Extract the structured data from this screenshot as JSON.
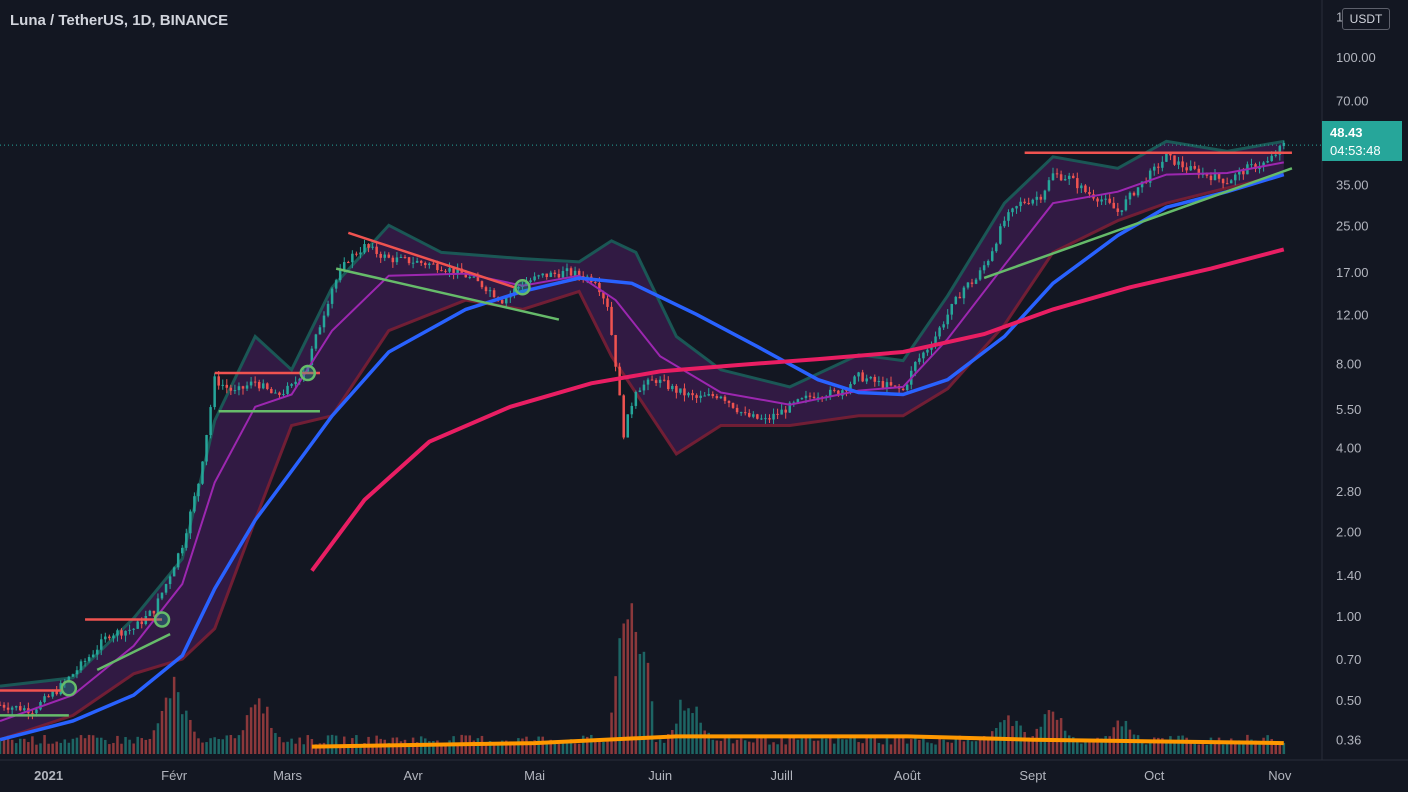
{
  "header": {
    "symbol_title": "Luna / TetherUS, 1D, BINANCE",
    "currency_label": "USDT"
  },
  "price_axis": {
    "ticks": [
      "140.00",
      "100.00",
      "70.00",
      "35.00",
      "25.00",
      "17.00",
      "12.00",
      "8.00",
      "5.50",
      "4.00",
      "2.80",
      "2.00",
      "1.40",
      "1.00",
      "0.70",
      "0.50",
      "0.36"
    ]
  },
  "time_axis": {
    "ticks": [
      "2021",
      "Févr",
      "Mars",
      "Avr",
      "Mai",
      "Juin",
      "Juill",
      "Août",
      "Sept",
      "Oct",
      "Nov"
    ]
  },
  "last_price": {
    "value": "48.43",
    "countdown": "04:53:48"
  },
  "colors": {
    "background": "#131722",
    "up": "#26a69a",
    "down": "#ef5350",
    "ma_fast": "#9c27b0",
    "ma_mid": "#2962ff",
    "ma_slow": "#e91e63",
    "volume_ma": "#ff9800",
    "band_fill": "#4a1d5e",
    "band_upper": "#1b5e5a",
    "band_lower": "#7a1f35",
    "resistance_line": "#f05350",
    "support_line": "#66bb6a"
  },
  "chart_data": {
    "type": "line",
    "scale": "log",
    "ylim": [
      0.32,
      150
    ],
    "x_range": [
      "2020-12-20",
      "2021-11-05"
    ],
    "series": [
      {
        "name": "",
        "kind": "price_path",
        "points": [
          [
            "2020-12-20",
            0.48
          ],
          [
            "2020-12-28",
            0.46
          ],
          [
            "2021-01-03",
            0.54
          ],
          [
            "2021-01-07",
            0.62
          ],
          [
            "2021-01-12",
            0.74
          ],
          [
            "2021-01-16",
            0.86
          ],
          [
            "2021-01-22",
            0.9
          ],
          [
            "2021-01-27",
            1.05
          ],
          [
            "2021-01-30",
            1.3
          ],
          [
            "2021-02-03",
            1.8
          ],
          [
            "2021-02-07",
            3.0
          ],
          [
            "2021-02-09",
            4.5
          ],
          [
            "2021-02-11",
            7.0
          ],
          [
            "2021-02-16",
            6.3
          ],
          [
            "2021-02-21",
            6.9
          ],
          [
            "2021-02-26",
            6.1
          ],
          [
            "2021-03-02",
            6.6
          ],
          [
            "2021-03-06",
            8.0
          ],
          [
            "2021-03-09",
            11.0
          ],
          [
            "2021-03-12",
            15.0
          ],
          [
            "2021-03-16",
            19.0
          ],
          [
            "2021-03-20",
            21.0
          ],
          [
            "2021-03-26",
            19.0
          ],
          [
            "2021-04-02",
            18.5
          ],
          [
            "2021-04-08",
            17.8
          ],
          [
            "2021-04-14",
            16.5
          ],
          [
            "2021-04-19",
            15.0
          ],
          [
            "2021-04-23",
            13.5
          ],
          [
            "2021-04-28",
            15.5
          ],
          [
            "2021-05-03",
            16.5
          ],
          [
            "2021-05-09",
            17.0
          ],
          [
            "2021-05-16",
            16.0
          ],
          [
            "2021-05-19",
            13.0
          ],
          [
            "2021-05-21",
            8.0
          ],
          [
            "2021-05-23",
            4.5
          ],
          [
            "2021-05-26",
            6.5
          ],
          [
            "2021-05-31",
            7.0
          ],
          [
            "2021-06-05",
            6.4
          ],
          [
            "2021-06-10",
            6.0
          ],
          [
            "2021-06-16",
            6.2
          ],
          [
            "2021-06-22",
            5.2
          ],
          [
            "2021-06-27",
            5.0
          ],
          [
            "2021-07-03",
            5.6
          ],
          [
            "2021-07-09",
            6.2
          ],
          [
            "2021-07-15",
            6.3
          ],
          [
            "2021-07-20",
            7.2
          ],
          [
            "2021-07-25",
            6.8
          ],
          [
            "2021-07-31",
            6.4
          ],
          [
            "2021-08-03",
            8.0
          ],
          [
            "2021-08-07",
            9.5
          ],
          [
            "2021-08-11",
            12.0
          ],
          [
            "2021-08-15",
            15.0
          ],
          [
            "2021-08-18",
            16.0
          ],
          [
            "2021-08-21",
            19.0
          ],
          [
            "2021-08-25",
            26.0
          ],
          [
            "2021-08-29",
            30.0
          ],
          [
            "2021-09-03",
            32.0
          ],
          [
            "2021-09-06",
            38.0
          ],
          [
            "2021-09-10",
            37.0
          ],
          [
            "2021-09-14",
            33.0
          ],
          [
            "2021-09-18",
            31.0
          ],
          [
            "2021-09-22",
            28.0
          ],
          [
            "2021-09-26",
            33.0
          ],
          [
            "2021-09-30",
            38.0
          ],
          [
            "2021-10-04",
            44.0
          ],
          [
            "2021-10-09",
            40.0
          ],
          [
            "2021-10-14",
            38.0
          ],
          [
            "2021-10-19",
            36.0
          ],
          [
            "2021-10-24",
            40.0
          ],
          [
            "2021-10-29",
            42.0
          ],
          [
            "2021-11-02",
            48.43
          ]
        ]
      },
      {
        "name": "",
        "kind": "ma_fast",
        "points": [
          [
            "2020-12-20",
            0.42
          ],
          [
            "2021-01-07",
            0.52
          ],
          [
            "2021-01-22",
            0.78
          ],
          [
            "2021-02-03",
            1.3
          ],
          [
            "2021-02-11",
            3.0
          ],
          [
            "2021-02-21",
            5.6
          ],
          [
            "2021-03-02",
            6.2
          ],
          [
            "2021-03-12",
            10.5
          ],
          [
            "2021-03-26",
            16.5
          ],
          [
            "2021-04-14",
            16.8
          ],
          [
            "2021-04-28",
            15.2
          ],
          [
            "2021-05-12",
            16.5
          ],
          [
            "2021-05-21",
            13.5
          ],
          [
            "2021-06-01",
            8.5
          ],
          [
            "2021-06-16",
            6.3
          ],
          [
            "2021-07-03",
            5.7
          ],
          [
            "2021-07-20",
            6.4
          ],
          [
            "2021-07-31",
            6.6
          ],
          [
            "2021-08-11",
            9.8
          ],
          [
            "2021-08-25",
            18.0
          ],
          [
            "2021-09-06",
            30.0
          ],
          [
            "2021-09-22",
            33.0
          ],
          [
            "2021-10-04",
            38.0
          ],
          [
            "2021-10-19",
            38.5
          ],
          [
            "2021-11-02",
            42.0
          ]
        ]
      },
      {
        "name": "",
        "kind": "ma_mid",
        "points": [
          [
            "2020-12-20",
            0.36
          ],
          [
            "2021-01-07",
            0.42
          ],
          [
            "2021-01-22",
            0.52
          ],
          [
            "2021-02-03",
            0.72
          ],
          [
            "2021-02-11",
            1.25
          ],
          [
            "2021-02-21",
            2.2
          ],
          [
            "2021-03-02",
            3.3
          ],
          [
            "2021-03-12",
            5.2
          ],
          [
            "2021-03-26",
            8.8
          ],
          [
            "2021-04-14",
            12.5
          ],
          [
            "2021-04-28",
            14.5
          ],
          [
            "2021-05-12",
            16.2
          ],
          [
            "2021-05-25",
            15.5
          ],
          [
            "2021-06-10",
            12.0
          ],
          [
            "2021-06-25",
            9.2
          ],
          [
            "2021-07-10",
            7.0
          ],
          [
            "2021-07-20",
            6.3
          ],
          [
            "2021-07-31",
            6.2
          ],
          [
            "2021-08-11",
            7.0
          ],
          [
            "2021-08-25",
            10.0
          ],
          [
            "2021-09-06",
            15.5
          ],
          [
            "2021-09-22",
            23.0
          ],
          [
            "2021-10-04",
            29.0
          ],
          [
            "2021-10-19",
            33.0
          ],
          [
            "2021-11-02",
            38.0
          ]
        ]
      },
      {
        "name": "",
        "kind": "ma_slow",
        "points": [
          [
            "2021-03-07",
            1.45
          ],
          [
            "2021-03-20",
            2.6
          ],
          [
            "2021-04-05",
            4.2
          ],
          [
            "2021-04-25",
            5.6
          ],
          [
            "2021-05-15",
            6.8
          ],
          [
            "2021-06-01",
            7.5
          ],
          [
            "2021-06-20",
            7.9
          ],
          [
            "2021-07-10",
            8.3
          ],
          [
            "2021-07-31",
            8.8
          ],
          [
            "2021-08-20",
            10.2
          ],
          [
            "2021-09-06",
            12.5
          ],
          [
            "2021-09-25",
            15.0
          ],
          [
            "2021-10-15",
            17.5
          ],
          [
            "2021-11-02",
            20.5
          ]
        ]
      },
      {
        "name": "",
        "kind": "band_upper",
        "points": [
          [
            "2020-12-20",
            0.56
          ],
          [
            "2021-01-07",
            0.6
          ],
          [
            "2021-01-22",
            0.98
          ],
          [
            "2021-02-03",
            1.6
          ],
          [
            "2021-02-11",
            5.0
          ],
          [
            "2021-02-21",
            10.0
          ],
          [
            "2021-03-02",
            7.6
          ],
          [
            "2021-03-12",
            15.0
          ],
          [
            "2021-03-26",
            25.0
          ],
          [
            "2021-04-08",
            20.0
          ],
          [
            "2021-04-28",
            19.0
          ],
          [
            "2021-05-12",
            18.5
          ],
          [
            "2021-05-20",
            22.0
          ],
          [
            "2021-05-26",
            20.0
          ],
          [
            "2021-06-05",
            10.0
          ],
          [
            "2021-06-16",
            7.6
          ],
          [
            "2021-07-03",
            6.6
          ],
          [
            "2021-07-20",
            8.6
          ],
          [
            "2021-07-31",
            8.2
          ],
          [
            "2021-08-11",
            14.0
          ],
          [
            "2021-08-25",
            30.0
          ],
          [
            "2021-09-06",
            44.0
          ],
          [
            "2021-09-22",
            40.0
          ],
          [
            "2021-10-04",
            50.0
          ],
          [
            "2021-10-19",
            46.0
          ],
          [
            "2021-11-02",
            50.0
          ]
        ]
      },
      {
        "name": "",
        "kind": "band_lower",
        "points": [
          [
            "2020-12-20",
            0.36
          ],
          [
            "2021-01-07",
            0.44
          ],
          [
            "2021-01-22",
            0.62
          ],
          [
            "2021-02-03",
            0.7
          ],
          [
            "2021-02-11",
            0.9
          ],
          [
            "2021-02-21",
            2.2
          ],
          [
            "2021-03-02",
            4.8
          ],
          [
            "2021-03-12",
            5.2
          ],
          [
            "2021-03-26",
            10.5
          ],
          [
            "2021-04-14",
            13.5
          ],
          [
            "2021-04-28",
            12.5
          ],
          [
            "2021-05-12",
            14.5
          ],
          [
            "2021-05-20",
            8.5
          ],
          [
            "2021-06-05",
            3.8
          ],
          [
            "2021-06-16",
            4.8
          ],
          [
            "2021-07-03",
            4.8
          ],
          [
            "2021-07-20",
            5.2
          ],
          [
            "2021-07-31",
            5.2
          ],
          [
            "2021-08-11",
            6.5
          ],
          [
            "2021-08-25",
            11.0
          ],
          [
            "2021-09-06",
            20.0
          ],
          [
            "2021-09-22",
            26.0
          ],
          [
            "2021-10-04",
            30.0
          ],
          [
            "2021-10-19",
            34.0
          ],
          [
            "2021-11-02",
            38.0
          ]
        ]
      }
    ],
    "volume": {
      "ma_points": [
        [
          "2021-03-07",
          0.34
        ],
        [
          "2021-05-01",
          0.35
        ],
        [
          "2021-06-05",
          0.37
        ],
        [
          "2021-08-01",
          0.37
        ],
        [
          "2021-09-01",
          0.36
        ],
        [
          "2021-11-02",
          0.35
        ]
      ],
      "peaks": [
        [
          "2021-02-01",
          0.62
        ],
        [
          "2021-02-22",
          0.55
        ],
        [
          "2021-05-25",
          1.35
        ],
        [
          "2021-06-08",
          0.58
        ],
        [
          "2021-08-26",
          0.48
        ],
        [
          "2021-09-06",
          0.5
        ],
        [
          "2021-09-23",
          0.44
        ]
      ]
    },
    "annotations": {
      "resistance_lines": [
        [
          "2020-12-20",
          0.54,
          "2021-01-04",
          0.54
        ],
        [
          "2021-01-10",
          0.97,
          "2021-01-29",
          0.97
        ],
        [
          "2021-02-11",
          7.4,
          "2021-03-09",
          7.4
        ],
        [
          "2021-03-16",
          23.5,
          "2021-04-26",
          15.0
        ],
        [
          "2021-08-30",
          45.5,
          "2021-11-04",
          45.5
        ]
      ],
      "support_lines": [
        [
          "2020-12-20",
          0.44,
          "2021-01-06",
          0.44
        ],
        [
          "2021-01-13",
          0.64,
          "2021-01-31",
          0.86
        ],
        [
          "2021-02-12",
          5.4,
          "2021-03-09",
          5.4
        ],
        [
          "2021-03-13",
          17.5,
          "2021-05-07",
          11.5
        ],
        [
          "2021-08-20",
          16.2,
          "2021-11-04",
          40.0
        ]
      ],
      "breakout_markers": [
        [
          "2021-01-06",
          0.55
        ],
        [
          "2021-01-29",
          0.97
        ],
        [
          "2021-03-06",
          7.4
        ],
        [
          "2021-04-28",
          15.0
        ]
      ]
    }
  }
}
